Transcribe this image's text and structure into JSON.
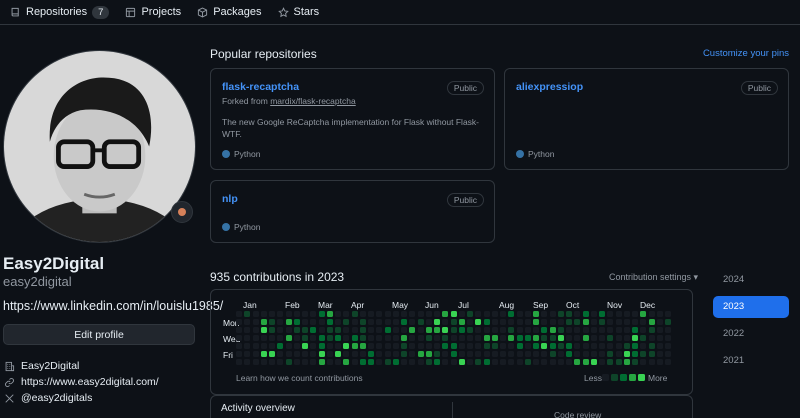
{
  "nav": {
    "tabs": [
      {
        "label": "Repositories",
        "icon": "repo-icon",
        "count": "7"
      },
      {
        "label": "Projects",
        "icon": "table-icon"
      },
      {
        "label": "Packages",
        "icon": "package-icon"
      },
      {
        "label": "Stars",
        "icon": "star-icon"
      }
    ]
  },
  "profile": {
    "display_name": "Easy2Digital",
    "username": "easy2digital",
    "bio": "https://www.linkedin.com/in/louislu1985/",
    "edit_button": "Edit profile",
    "company": "Easy2Digital",
    "website": "https://www.easy2digital.com/",
    "social": "@easy2digitals"
  },
  "popular": {
    "title": "Popular repositories",
    "customize": "Customize your pins",
    "repos": [
      {
        "name": "flask-recaptcha",
        "visibility": "Public",
        "fork_prefix": "Forked from ",
        "fork_source": "mardix/flask-recaptcha",
        "description": "The new Google ReCaptcha implementation for Flask without Flask-WTF.",
        "language": "Python"
      },
      {
        "name": "aliexpressiop",
        "visibility": "Public",
        "language": "Python"
      },
      {
        "name": "nlp",
        "visibility": "Public",
        "language": "Python"
      }
    ]
  },
  "contributions": {
    "title": "935 contributions in 2023",
    "settings": "Contribution settings ▾",
    "months": [
      "Jan",
      "Feb",
      "Mar",
      "Apr",
      "May",
      "Jun",
      "Jul",
      "Aug",
      "Sep",
      "Oct",
      "Nov",
      "Dec"
    ],
    "days": [
      "Mon",
      "Wed",
      "Fri"
    ],
    "learn_link": "Learn how we count contributions",
    "legend_less": "Less",
    "legend_more": "More",
    "levels": [
      "#161b22",
      "#0e4429",
      "#006d32",
      "#26a641",
      "#39d353"
    ]
  },
  "years": [
    "2024",
    "2023",
    "2022",
    "2021"
  ],
  "selected_year": "2023",
  "activity": {
    "title": "Activity overview",
    "code_review": "Code review"
  },
  "colors": {
    "background": "#0d1117",
    "border": "#30363d",
    "link": "#4493f8",
    "accent": "#1f6feb",
    "python": "#3572A5"
  }
}
